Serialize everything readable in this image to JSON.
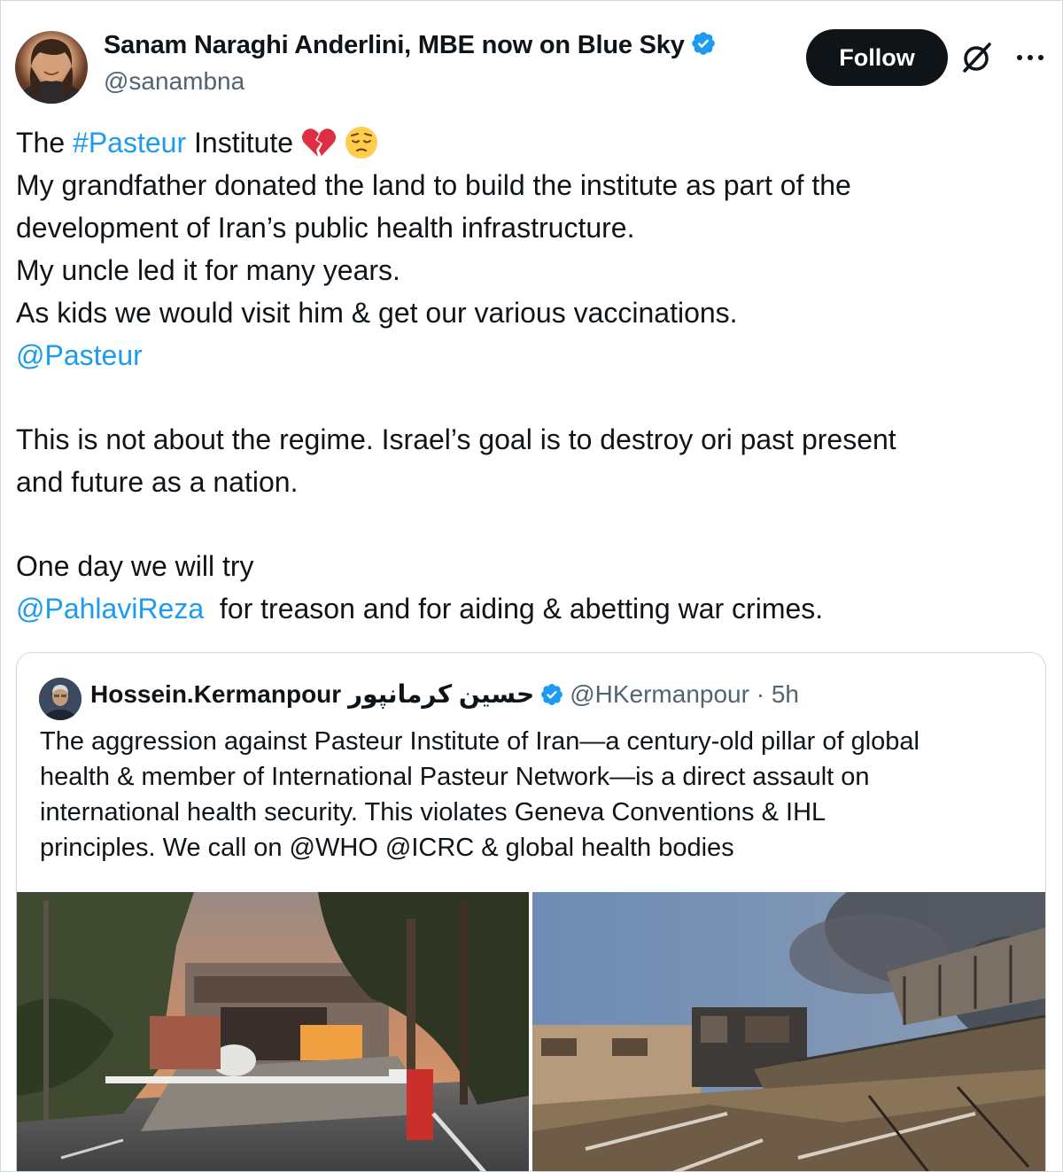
{
  "author": {
    "display_name": "Sanam Naraghi Anderlini, MBE now on Blue Sky",
    "handle": "@sanambna",
    "verified": true
  },
  "actions": {
    "follow_label": "Follow"
  },
  "tweet": {
    "lines": [
      {
        "pre": "The ",
        "link": "#Pasteur",
        "post": " Institute"
      },
      {
        "text": "My grandfather donated the land to build the institute as part of the"
      },
      {
        "text": "development of Iran’s public health infrastructure."
      },
      {
        "text": "My uncle led it for many years."
      },
      {
        "text": "As kids we would visit him & get our various vaccinations."
      },
      {
        "link": "@Pasteur"
      },
      {
        "text": "This is not about the regime. Israel’s goal is to destroy ori past present"
      },
      {
        "text": "and future as a nation."
      },
      {
        "text": "One day we will try"
      },
      {
        "link": "@PahlaviReza",
        "post": "  for treason and for aiding & abetting war crimes."
      }
    ]
  },
  "quoted": {
    "display_name": "Hossein.Kermanpour حسین کرمانپور",
    "handle": "@HKermanpour",
    "separator": "·",
    "time": "5h",
    "lines": [
      "The aggression against Pasteur Institute of Iran—a century-old pillar of global",
      "health & member of International Pasteur Network—is a direct assault on",
      "international health security. This violates Geneva Conventions & IHL",
      "principles. We call on @WHO @ICRC & global health bodies"
    ]
  },
  "colors": {
    "link": "#1d9bf0",
    "verified": "#1d9bf0",
    "text": "#0f1419",
    "muted": "#536471",
    "follow_bg": "#0f1419"
  },
  "icons": [
    "verified-badge-icon",
    "grok-icon",
    "more-icon",
    "broken-heart-emoji",
    "pensive-face-emoji"
  ]
}
